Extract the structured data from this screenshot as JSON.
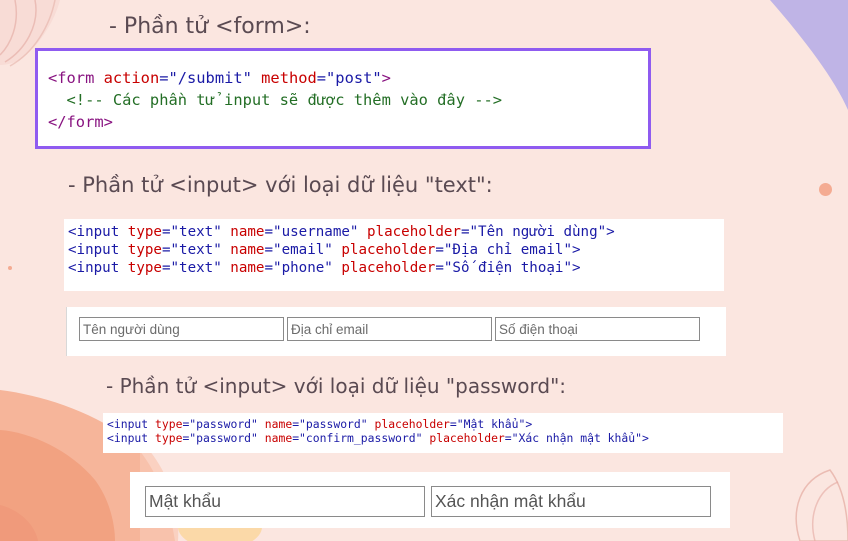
{
  "headings": {
    "form": "- Phần tử <form>:",
    "text_input": "- Phần tử <input> với loại dữ liệu \"text\":",
    "password_input": "- Phần tử <input> với loại dữ liệu \"password\":"
  },
  "form_code": {
    "line1": {
      "tag_open": "<form",
      "attr1": " action",
      "val1": "=\"/submit\"",
      "attr2": " method",
      "val2": "=\"post\"",
      "tag_close": ">"
    },
    "line2": "  <!-- Các phần tử input sẽ được thêm vào đây -->",
    "line3": "</form>"
  },
  "text_code": [
    {
      "tag": "<input",
      "type_attr": " type",
      "type_val": "=\"text\"",
      "name_attr": " name",
      "name_val": "=\"username\"",
      "ph_attr": " placeholder",
      "ph_val": "=\"Tên người dùng\"",
      "end": ">"
    },
    {
      "tag": "<input",
      "type_attr": " type",
      "type_val": "=\"text\"",
      "name_attr": " name",
      "name_val": "=\"email\"",
      "ph_attr": " placeholder",
      "ph_val": "=\"Địa chỉ email\"",
      "end": ">"
    },
    {
      "tag": "<input",
      "type_attr": " type",
      "type_val": "=\"text\"",
      "name_attr": " name",
      "name_val": "=\"phone\"",
      "ph_attr": " placeholder",
      "ph_val": "=\"Số điện thoại\"",
      "end": ">"
    }
  ],
  "password_code": [
    {
      "tag": "<input",
      "type_attr": " type",
      "type_val": "=\"password\"",
      "name_attr": " name",
      "name_val": "=\"password\"",
      "ph_attr": " placeholder",
      "ph_val": "=\"Mật khẩu\"",
      "end": ">"
    },
    {
      "tag": "<input",
      "type_attr": " type",
      "type_val": "=\"password\"",
      "name_attr": " name",
      "name_val": "=\"confirm_password\"",
      "ph_attr": " placeholder",
      "ph_val": "=\"Xác nhận mật khẩu\"",
      "end": ">"
    }
  ],
  "text_inputs": {
    "username_placeholder": "Tên người dùng",
    "email_placeholder": "Địa chỉ email",
    "phone_placeholder": "Số điện thoại"
  },
  "password_inputs": {
    "password_placeholder": "Mật khẩu",
    "confirm_placeholder": "Xác nhận mật khẩu"
  },
  "colors": {
    "background": "#fbe6e0",
    "frame_border": "#8f5bf0",
    "tag": "#881280",
    "attribute": "#c80000",
    "value": "#1a1aa6",
    "comment": "#236e25"
  }
}
